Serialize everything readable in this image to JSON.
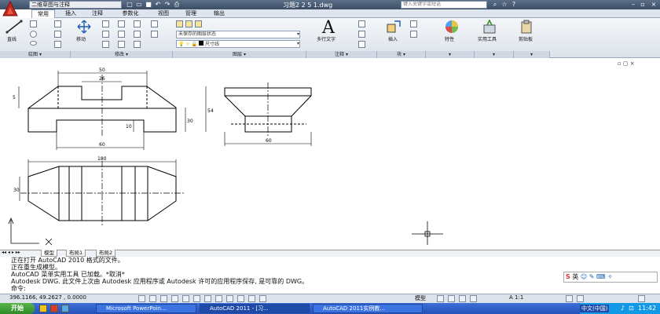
{
  "titlebar": {
    "workspace": "二维草图与注释",
    "document_title": "习题2 2 5 1.dwg",
    "search_placeholder": "键入关键字或短语",
    "quick_access_icons": [
      "new-icon",
      "open-icon",
      "save-icon",
      "undo-icon",
      "redo-icon",
      "print-icon"
    ]
  },
  "menu": {
    "tabs": [
      "常用",
      "插入",
      "注释",
      "参数化",
      "视图",
      "管理",
      "输出"
    ],
    "active": "常用"
  },
  "ribbon": {
    "draw": {
      "line_label": "直线",
      "footer": "绘图"
    },
    "modify": {
      "move_label": "移动",
      "footer": "修改"
    },
    "layers": {
      "layer_state": "未保存的图层状态",
      "current_layer": "尺寸线",
      "footer": "图层"
    },
    "annotation": {
      "mtext_label": "多行文字",
      "footer": "注释"
    },
    "block": {
      "insert_label": "插入",
      "footer": "块"
    },
    "properties": {
      "label": "特性"
    },
    "utilities": {
      "label": "实用工具"
    },
    "clipboard": {
      "label": "剪贴板"
    }
  },
  "drawing": {
    "dims": {
      "top_width": "50",
      "notch_width": "26",
      "base_width": "60",
      "overall_length": "180",
      "left_height": "5",
      "right_height": "30",
      "small_height": "10",
      "total_height": "54",
      "side_width": "60",
      "left_section": "30"
    }
  },
  "layout_tabs": [
    "模型",
    "布局1",
    "布局2"
  ],
  "command_lines": [
    "正在打开 AutoCAD 2010 格式的文件。",
    "正在重生成模型。",
    "AutoCAD 菜单实用工具 已加载。*取消*",
    "Autodesk DWG.   此文件上次由 Autodesk 应用程序或 Autodesk 许可的应用程序保存, 是可靠的 DWG。",
    "命令:"
  ],
  "status": {
    "coordinates": "396.1166, 49.2627 , 0.0000",
    "mode": "模型",
    "scale": "A 1:1"
  },
  "taskbar": {
    "start": "开始",
    "tasks": [
      "Microsoft PowerPoin...",
      "AutoCAD 2011 - [习...",
      "AutoCAD 2011实例教..."
    ],
    "input_method": "中文(中国)",
    "clock": "11:42"
  },
  "ime": {
    "label": "英"
  },
  "colors": {
    "title_bar": "#3c4e66",
    "ribbon": "#dde3eb",
    "taskbar": "#2452b9",
    "start_button": "#2e8b2a"
  }
}
